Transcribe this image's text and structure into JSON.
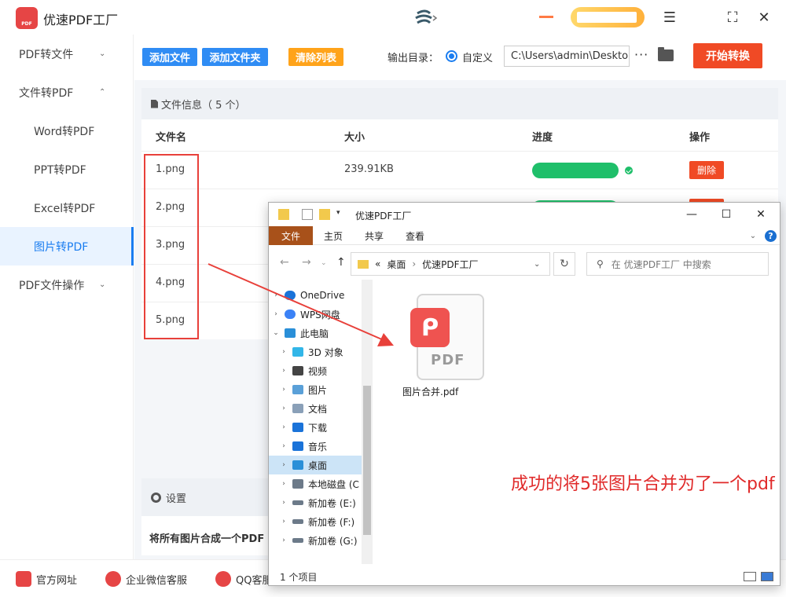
{
  "app": {
    "title": "优速PDF工厂"
  },
  "window_controls": {
    "menu": "☰",
    "maximize": "⛶",
    "close": "✕"
  },
  "sidebar": {
    "items": [
      {
        "label": "PDF转文件",
        "chevron": "⌄"
      },
      {
        "label": "文件转PDF",
        "chevron": "⌃"
      },
      {
        "label": "Word转PDF"
      },
      {
        "label": "PPT转PDF"
      },
      {
        "label": "Excel转PDF"
      },
      {
        "label": "图片转PDF"
      },
      {
        "label": "PDF文件操作",
        "chevron": "⌄"
      }
    ]
  },
  "toolbar": {
    "add_file": "添加文件",
    "add_folder": "添加文件夹",
    "clear_list": "清除列表",
    "output_label": "输出目录：",
    "radio_label": "自定义",
    "output_path": "C:\\Users\\admin\\Deskto",
    "more": "···",
    "start": "开始转换"
  },
  "file_panel": {
    "header": "文件信息（ 5 个）",
    "columns": {
      "name": "文件名",
      "size": "大小",
      "progress": "进度",
      "action": "操作"
    },
    "rows": [
      {
        "name": "1.png",
        "size": "239.91KB",
        "progress": 1.0,
        "delete": "删除"
      },
      {
        "name": "2.png"
      },
      {
        "name": "3.png"
      },
      {
        "name": "4.png"
      },
      {
        "name": "5.png"
      }
    ]
  },
  "settings": {
    "header": "设置",
    "text": "将所有图片合成一个PDF"
  },
  "footer": {
    "website": "官方网址",
    "wechat": "企业微信客服",
    "qq": "QQ客服"
  },
  "explorer": {
    "title": "优速PDF工厂",
    "tabs": [
      "文件",
      "主页",
      "共享",
      "查看"
    ],
    "help": "?",
    "address": {
      "prefix": "«",
      "crumbs": [
        "桌面",
        "优速PDF工厂"
      ]
    },
    "search_placeholder": "在 优速PDF工厂 中搜索",
    "nav_items": [
      {
        "label": "OneDrive",
        "expander": "›",
        "indent": 0
      },
      {
        "label": "WPS网盘",
        "expander": "›",
        "indent": 0
      },
      {
        "label": "此电脑",
        "expander": "⌄",
        "indent": 0
      },
      {
        "label": "3D 对象",
        "expander": "›",
        "indent": 1
      },
      {
        "label": "视频",
        "expander": "›",
        "indent": 1
      },
      {
        "label": "图片",
        "expander": "›",
        "indent": 1
      },
      {
        "label": "文档",
        "expander": "›",
        "indent": 1
      },
      {
        "label": "下载",
        "expander": "›",
        "indent": 1
      },
      {
        "label": "音乐",
        "expander": "›",
        "indent": 1
      },
      {
        "label": "桌面",
        "expander": "›",
        "indent": 1,
        "selected": true
      },
      {
        "label": "本地磁盘 (C",
        "expander": "›",
        "indent": 1
      },
      {
        "label": "新加卷 (E:)",
        "expander": "›",
        "indent": 1
      },
      {
        "label": "新加卷 (F:)",
        "expander": "›",
        "indent": 1
      },
      {
        "label": "新加卷 (G:)",
        "expander": "›",
        "indent": 1
      }
    ],
    "file": {
      "name": "图片合并.pdf",
      "badge_word": "PDF"
    },
    "status": "1 个项目"
  },
  "annotation": {
    "text": "成功的将5张图片合并为了一个pdf"
  },
  "colors": {
    "primary_blue": "#2f8cf4",
    "orange": "#ffa31a",
    "start_red": "#f04a25",
    "progress_green": "#1fbf6a",
    "annotation_red": "#e02a2a"
  }
}
